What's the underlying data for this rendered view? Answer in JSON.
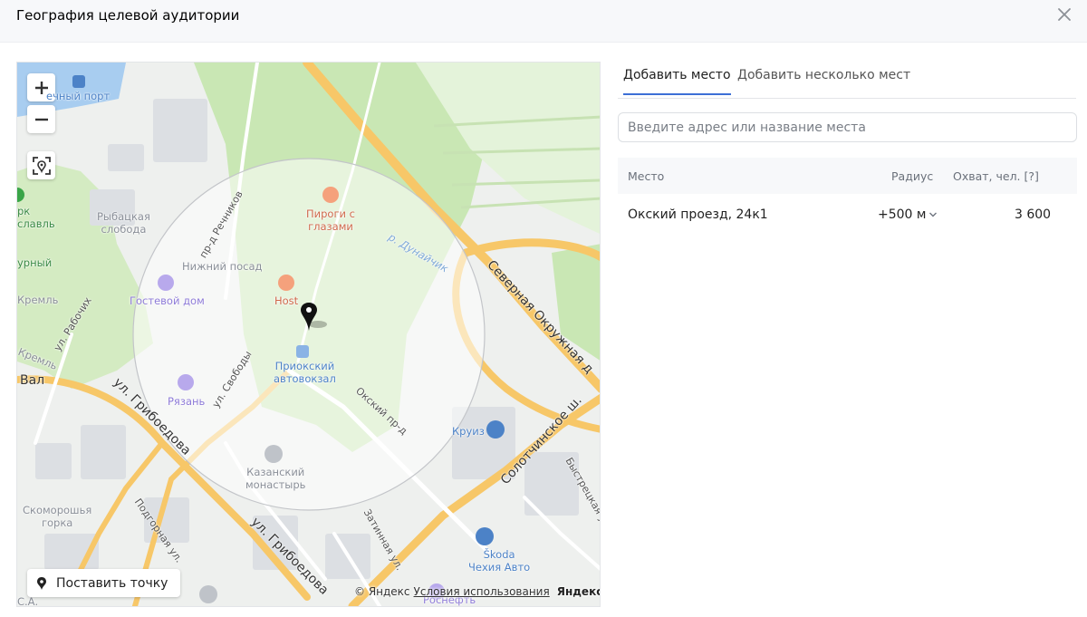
{
  "header": {
    "title": "География целевой аудитории"
  },
  "map": {
    "zoom_in": "+",
    "zoom_out": "−",
    "labels": {
      "river_port": "ечный порт",
      "fishing_settlement": "Рыбацкая\nслобода",
      "park": "рк\nславль",
      "nizhny_posad": "Нижний посад",
      "guest_house": "Гостевой дом",
      "host": "Host",
      "pies": "Пироги с\nглазами",
      "bus_station": "Приокский\nавтовокзал",
      "ryazan": "Рязань",
      "kazan_monastery": "Казанский\nмонастырь",
      "kruiz": "Круиз",
      "skoda": "Škoda\nЧехия Авто",
      "skomoroshya": "Скоморошья\nгорка",
      "rosneft": "Роснефть",
      "dunaychik": "р. Дунайчик",
      "rechnikov": "пр-д Речников",
      "svobody": "ул. Свободы",
      "oksky_pr": "Окский пр-д",
      "griboedova1": "ул. Грибоедова",
      "griboedova2": "ул. Грибоедова",
      "podgornaya": "Подгорная ул.",
      "zatinnaya": "Затинная ул.",
      "severnaya": "Северная Окружная д",
      "solotchinskoe": "Солотчинское ш.",
      "bystretskaya": "Быстрецкая ул",
      "rabochih": "ул. Рабочих",
      "kreml1": "Кремль",
      "kreml2": "Кремль",
      "val": "Вал",
      "urny": "урный",
      "sa": "С.А."
    },
    "set_point_label": "Поставить точку",
    "copyright": "© Яндекс",
    "terms_link": "Условия использования",
    "brand": "Яндекс"
  },
  "tabs": [
    {
      "label": "Добавить место",
      "active": true
    },
    {
      "label": "Добавить несколько мест",
      "active": false
    }
  ],
  "search": {
    "placeholder": "Введите адрес или название места",
    "value": ""
  },
  "table": {
    "headers": {
      "place": "Место",
      "radius": "Радиус",
      "reach": "Охват, чел. [?]"
    },
    "rows": [
      {
        "place": "Окский проезд, 24к1",
        "radius": "+500 м",
        "reach": "3 600"
      }
    ]
  },
  "colors": {
    "accent": "#3d6fd6",
    "road_major": "#f7c768",
    "park": "#c9e7b4",
    "water": "#a8cdf0"
  }
}
